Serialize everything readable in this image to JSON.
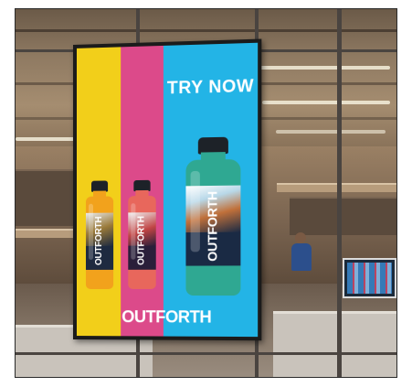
{
  "poster": {
    "headline": "TRY NOW",
    "brand": "OUTFORTH",
    "stripe_colors": [
      "#f2cf1a",
      "#dc4a8a",
      "#23b4e6"
    ]
  },
  "bottles": [
    {
      "flavor_color": "#f2a21c",
      "brand": "OUTFORTH"
    },
    {
      "flavor_color": "#e8675c",
      "brand": "OUTFORTH"
    },
    {
      "flavor_color": "#2fa892",
      "brand": "OUTFORTH"
    }
  ]
}
